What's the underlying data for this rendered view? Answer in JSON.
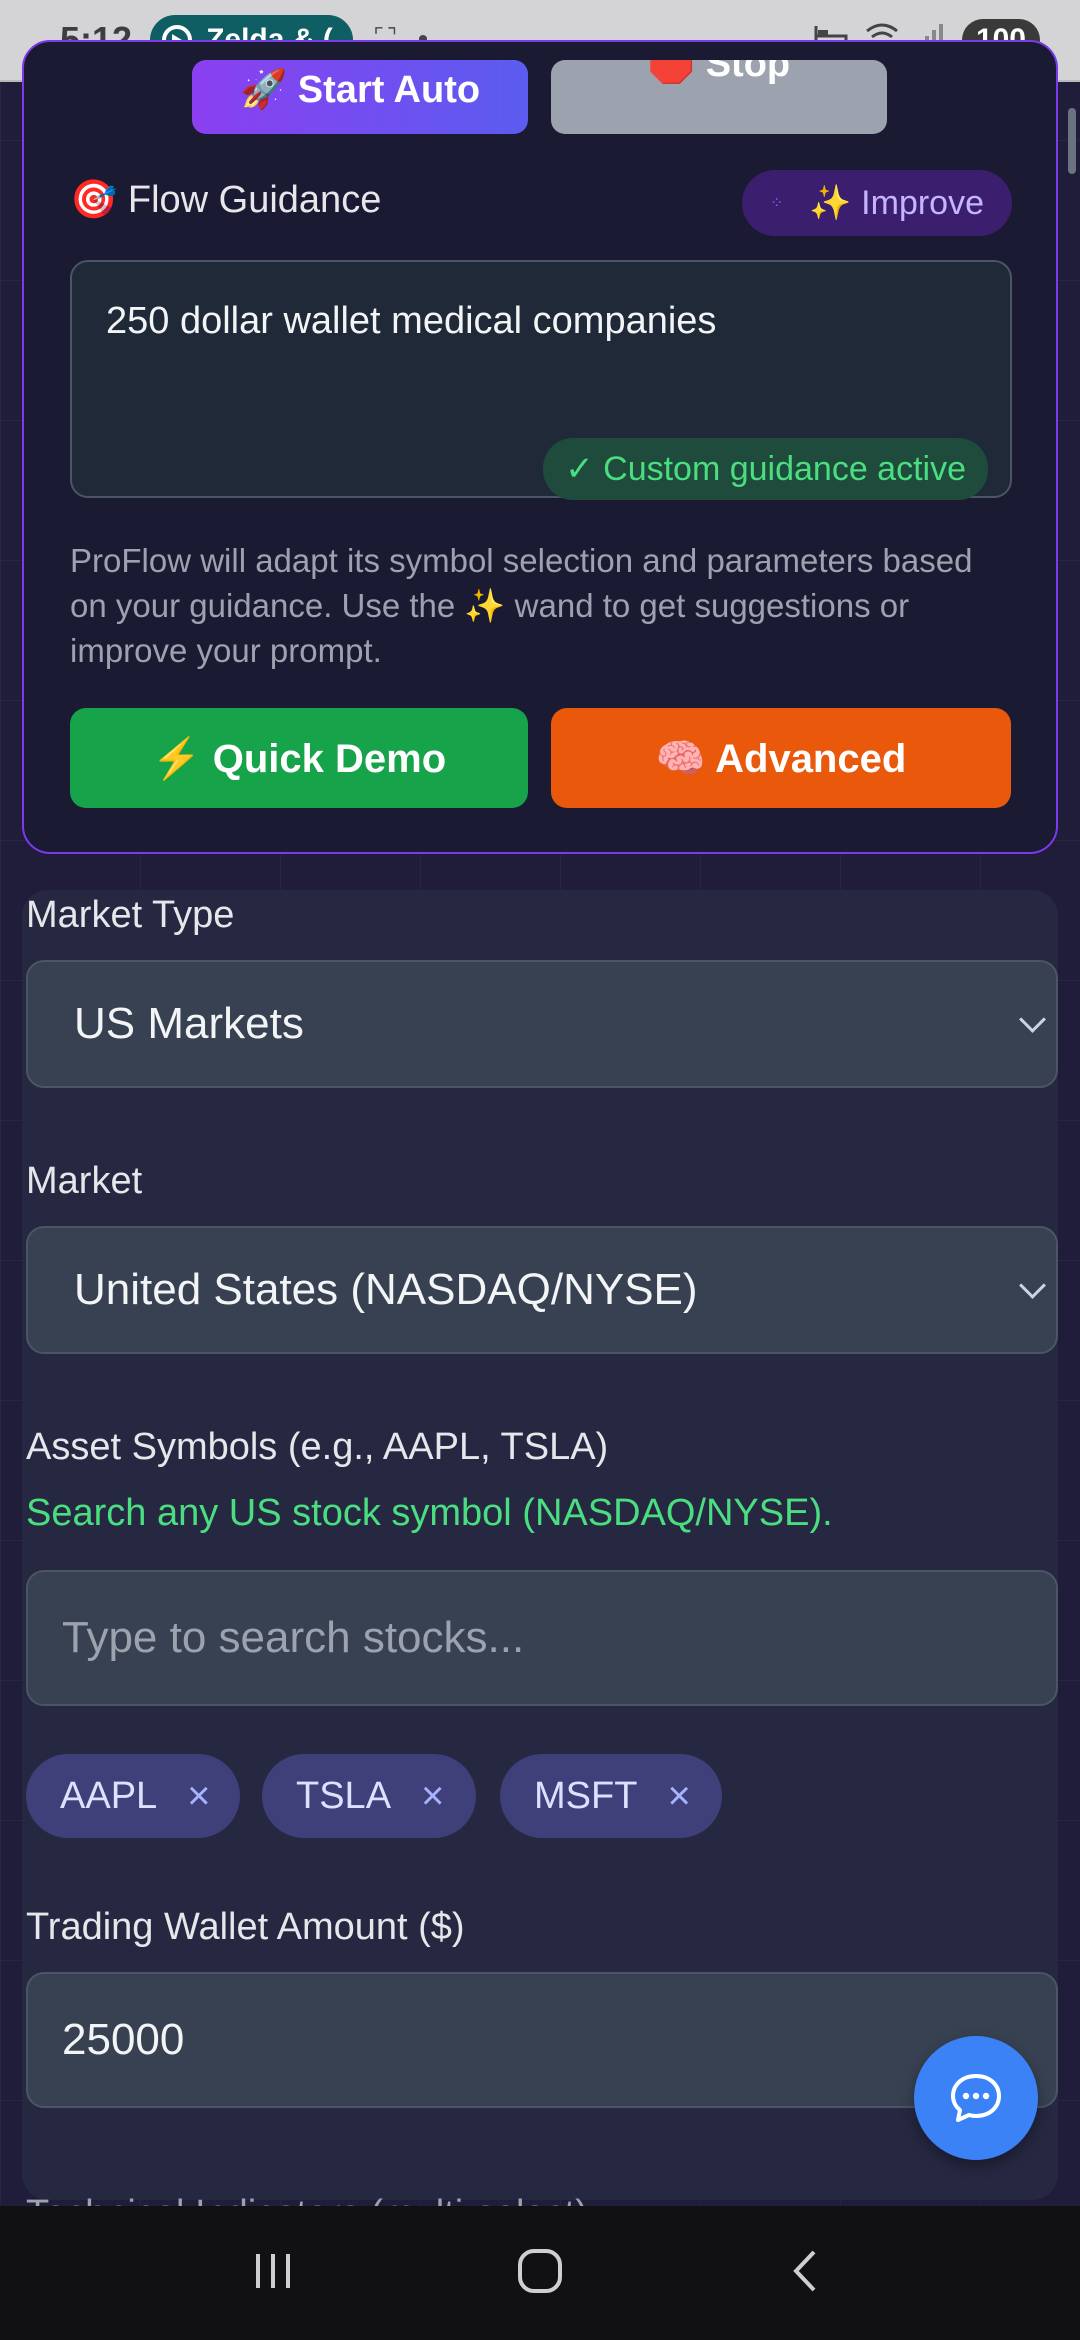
{
  "status_bar": {
    "time": "5:12",
    "notification": "Zelda & (",
    "battery": "100",
    "icons": [
      "screenshot-icon",
      "dot-icon",
      "bed-icon",
      "wifi-icon",
      "signal-icon"
    ]
  },
  "card": {
    "start_auto_label": "🚀 Start Auto",
    "stop_label": "🛑 Stop",
    "flow_title": "🎯 Flow Guidance",
    "improve_label": "✨ Improve",
    "guidance_text": "250 dollar wallet medical companies",
    "active_badge": "✓ Custom guidance active",
    "help_text": "ProFlow will adapt its symbol selection and parameters based on your guidance. Use the ✨ wand to get suggestions or improve your prompt.",
    "quick_demo_label": "⚡ Quick Demo",
    "advanced_label": "🧠 Advanced"
  },
  "form": {
    "market_type_label": "Market Type",
    "market_type_value": "US Markets",
    "market_label": "Market",
    "market_value": "United States (NASDAQ/NYSE)",
    "symbols_label": "Asset Symbols (e.g., AAPL, TSLA)",
    "symbols_hint": "Search any US stock symbol (NASDAQ/NYSE).",
    "search_placeholder": "Type to search stocks...",
    "chips": [
      "AAPL",
      "TSLA",
      "MSFT"
    ],
    "chip_remove": "×",
    "wallet_label": "Trading Wallet Amount ($)",
    "wallet_value": "25000",
    "indicators_label": "Technical Indicators (multi-select)"
  },
  "colors": {
    "accent_purple": "#7c3aed",
    "green": "#16a34a",
    "orange": "#ea580c",
    "chip": "#3f3f7a",
    "fab": "#3b82f6"
  }
}
